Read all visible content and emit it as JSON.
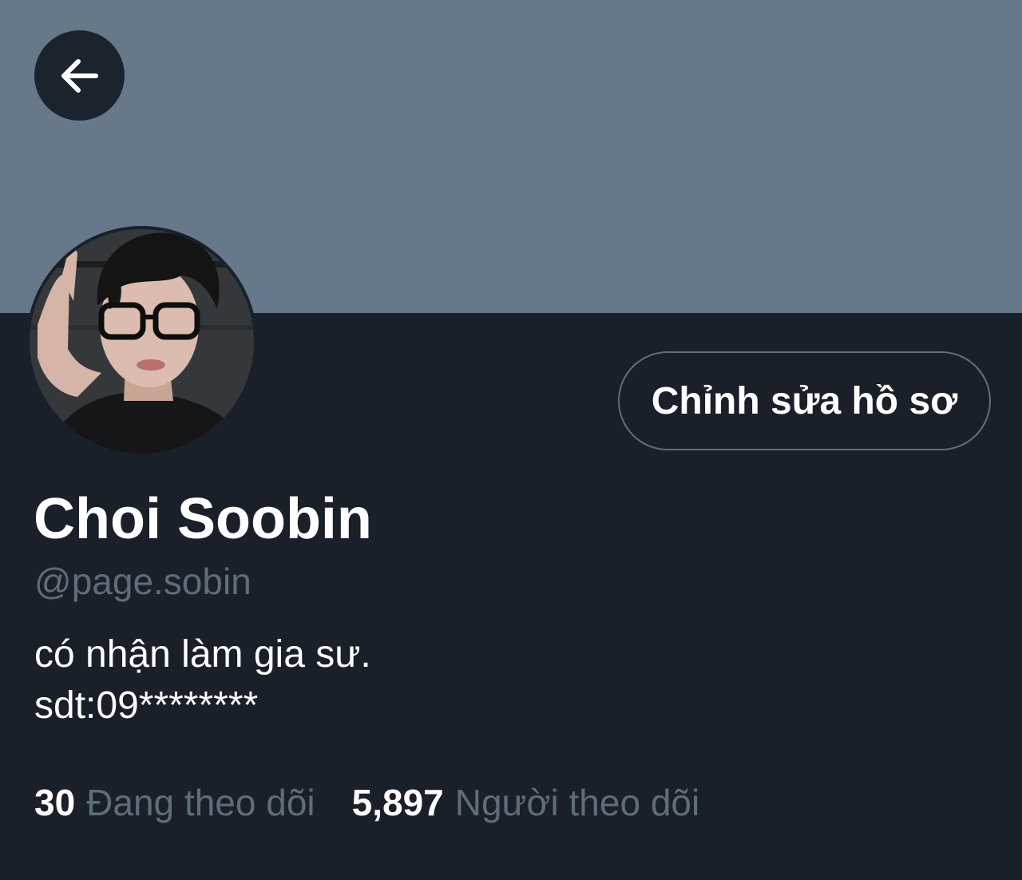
{
  "profile": {
    "display_name": "Choi Soobin",
    "handle": "@page.sobin",
    "bio_line1": "có nhận làm gia sư.",
    "bio_line2": "sdt:09********",
    "edit_label": "Chỉnh sửa hồ sơ"
  },
  "stats": {
    "following_count": "30",
    "following_label": "Đang theo dõi",
    "followers_count": "5,897",
    "followers_label": "Người theo dõi"
  },
  "icons": {
    "back": "arrow-left-icon"
  },
  "colors": {
    "banner": "#66788a",
    "background": "#192029",
    "muted_text": "#5f6c7a",
    "primary_text": "#ffffff",
    "button_border": "#5f6f80"
  }
}
